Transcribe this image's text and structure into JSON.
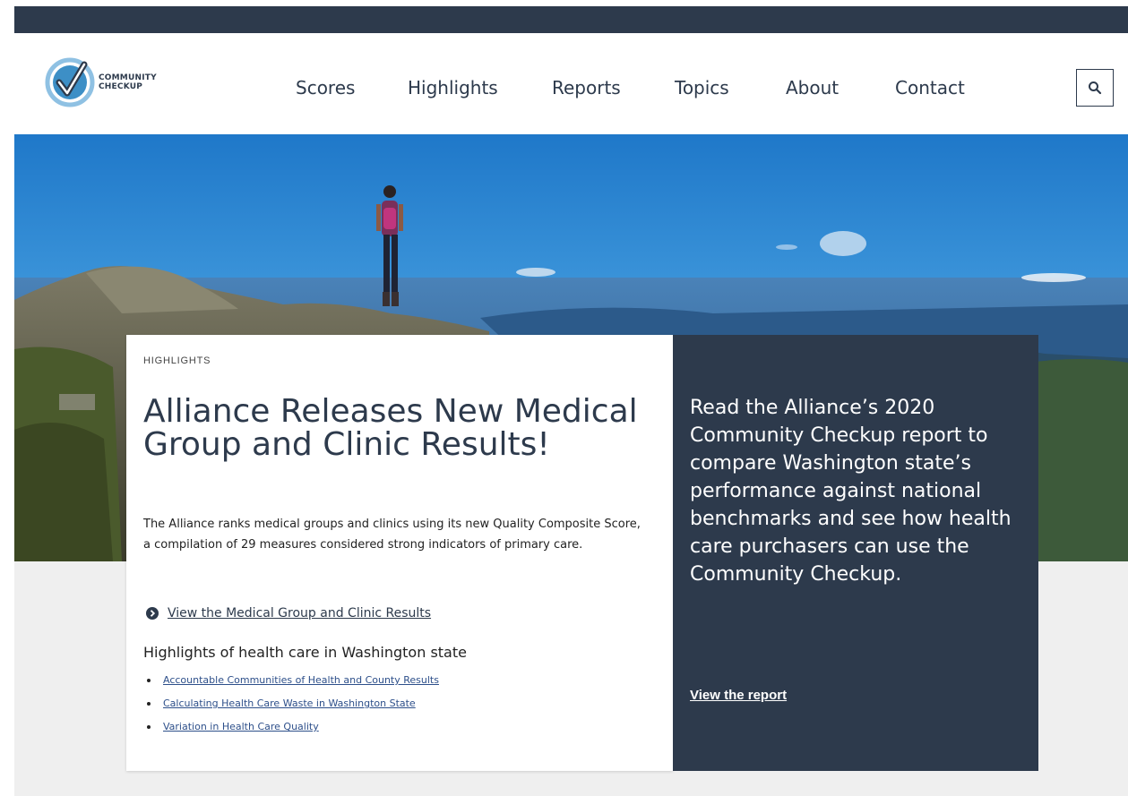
{
  "brand": {
    "logo_line1": "COMMUNITY",
    "logo_line2": "CHECKUP",
    "colors": {
      "navy": "#2d3a4c",
      "logo_blue": "#3d8fc6",
      "link": "#2d4f8a"
    }
  },
  "nav": {
    "items": [
      "Scores",
      "Highlights",
      "Reports",
      "Topics",
      "About",
      "Contact"
    ],
    "search_icon": "search-icon"
  },
  "hero": {
    "image": "hiker-on-mountain-summit-photo"
  },
  "card": {
    "kicker": "HIGHLIGHTS",
    "headline": "Alliance Releases New Medical Group and Clinic Results!",
    "body": "The Alliance ranks medical groups and clinics using its new Quality Composite Score, a compilation of 29 measures considered strong indicators of primary care.",
    "cta_label": "View the Medical Group and Clinic Results",
    "cta_icon": "circle-chevron-right-icon",
    "sub_heading": "Highlights of health care in Washington state",
    "links": [
      "Accountable Communities of Health and County Results",
      "Calculating Health Care Waste in Washington State",
      "Variation in Health Care Quality"
    ]
  },
  "side": {
    "text": "Read the Alliance’s 2020 Community Checkup report to compare Washington state’s performance against national benchmarks and see how health care purchasers can use the Community Checkup.",
    "link": "View the report"
  }
}
